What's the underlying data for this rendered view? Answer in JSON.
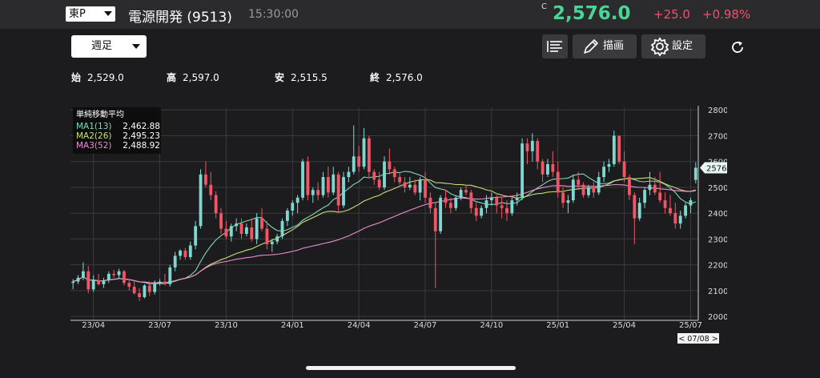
{
  "header": {
    "market": "東P",
    "stock_name": "電源開発 (9513)",
    "time": "15:30:00",
    "close_flag": "C",
    "price": "2,576.0",
    "change": "+25.0",
    "change_pct": "+0.98%",
    "colors": {
      "up": "#48d597",
      "down": "#f0506e"
    }
  },
  "toolbar": {
    "period": "週足",
    "draw_label": "描画",
    "settings_label": "設定",
    "icons": [
      "list-icon",
      "pencil-icon",
      "gear-icon",
      "refresh-icon"
    ]
  },
  "ohlc": {
    "open_label": "始",
    "open": "2,529.0",
    "high_label": "高",
    "high": "2,597.0",
    "low_label": "安",
    "low": "2,515.5",
    "close_label": "終",
    "close": "2,576.0"
  },
  "legend": {
    "title": "単純移動平均",
    "items": [
      {
        "name": "MA1(13)",
        "value": "2,462.88",
        "color": "#7fd9b6"
      },
      {
        "name": "MA2(26)",
        "value": "2,495.23",
        "color": "#c8e07a"
      },
      {
        "name": "MA3(52)",
        "value": "2,488.92",
        "color": "#e88fd0"
      }
    ]
  },
  "chart_data": {
    "type": "candlestick",
    "ylim": [
      1985,
      2810
    ],
    "y_ticks": [
      "2000",
      "2100",
      "2200",
      "2300",
      "2400",
      "2500",
      "2600",
      "2700",
      "2800"
    ],
    "x_ticks": [
      {
        "label": "23/04",
        "index": 4
      },
      {
        "label": "23/07",
        "index": 17
      },
      {
        "label": "23/10",
        "index": 30
      },
      {
        "label": "24/01",
        "index": 43
      },
      {
        "label": "24/04",
        "index": 56
      },
      {
        "label": "24/07",
        "index": 69
      },
      {
        "label": "24/10",
        "index": 82
      },
      {
        "label": "25/01",
        "index": 95
      },
      {
        "label": "25/04",
        "index": 108
      },
      {
        "label": "25/07",
        "index": 121
      }
    ],
    "last_price_label": "2576.0",
    "last_price": 2576,
    "date_label": "< 07/08 >",
    "up_color": "#7fd8d0",
    "down_color": "#f25565",
    "ma_colors": [
      "#7fd9b6",
      "#c8e07a",
      "#e88fd0"
    ],
    "candles": [
      [
        2130,
        2145,
        2105,
        2135
      ],
      [
        2135,
        2160,
        2125,
        2150
      ],
      [
        2150,
        2210,
        2140,
        2175
      ],
      [
        2175,
        2195,
        2090,
        2105
      ],
      [
        2105,
        2160,
        2095,
        2140
      ],
      [
        2140,
        2165,
        2120,
        2125
      ],
      [
        2125,
        2150,
        2110,
        2140
      ],
      [
        2140,
        2175,
        2130,
        2165
      ],
      [
        2165,
        2180,
        2150,
        2160
      ],
      [
        2160,
        2185,
        2145,
        2175
      ],
      [
        2175,
        2180,
        2120,
        2130
      ],
      [
        2130,
        2145,
        2100,
        2115
      ],
      [
        2115,
        2140,
        2085,
        2090
      ],
      [
        2090,
        2110,
        2060,
        2075
      ],
      [
        2075,
        2125,
        2070,
        2120
      ],
      [
        2120,
        2135,
        2080,
        2095
      ],
      [
        2095,
        2140,
        2085,
        2130
      ],
      [
        2130,
        2145,
        2120,
        2135
      ],
      [
        2135,
        2165,
        2120,
        2125
      ],
      [
        2125,
        2200,
        2115,
        2190
      ],
      [
        2190,
        2250,
        2175,
        2235
      ],
      [
        2235,
        2260,
        2220,
        2255
      ],
      [
        2255,
        2265,
        2220,
        2230
      ],
      [
        2230,
        2290,
        2220,
        2275
      ],
      [
        2275,
        2370,
        2260,
        2350
      ],
      [
        2350,
        2570,
        2340,
        2550
      ],
      [
        2550,
        2600,
        2500,
        2510
      ],
      [
        2510,
        2560,
        2450,
        2470
      ],
      [
        2470,
        2485,
        2380,
        2400
      ],
      [
        2400,
        2420,
        2320,
        2340
      ],
      [
        2340,
        2370,
        2300,
        2310
      ],
      [
        2310,
        2360,
        2290,
        2350
      ],
      [
        2350,
        2380,
        2330,
        2360
      ],
      [
        2360,
        2380,
        2300,
        2320
      ],
      [
        2320,
        2360,
        2310,
        2345
      ],
      [
        2345,
        2380,
        2290,
        2300
      ],
      [
        2300,
        2400,
        2280,
        2380
      ],
      [
        2380,
        2420,
        2330,
        2340
      ],
      [
        2340,
        2370,
        2260,
        2280
      ],
      [
        2280,
        2300,
        2250,
        2290
      ],
      [
        2290,
        2320,
        2280,
        2310
      ],
      [
        2310,
        2380,
        2300,
        2370
      ],
      [
        2370,
        2420,
        2350,
        2410
      ],
      [
        2410,
        2450,
        2390,
        2440
      ],
      [
        2440,
        2470,
        2400,
        2460
      ],
      [
        2460,
        2610,
        2450,
        2600
      ],
      [
        2600,
        2620,
        2450,
        2470
      ],
      [
        2470,
        2500,
        2440,
        2490
      ],
      [
        2490,
        2520,
        2450,
        2470
      ],
      [
        2470,
        2560,
        2460,
        2540
      ],
      [
        2540,
        2580,
        2460,
        2480
      ],
      [
        2480,
        2580,
        2470,
        2550
      ],
      [
        2550,
        2560,
        2400,
        2430
      ],
      [
        2430,
        2560,
        2420,
        2540
      ],
      [
        2540,
        2580,
        2520,
        2560
      ],
      [
        2560,
        2740,
        2550,
        2620
      ],
      [
        2620,
        2660,
        2560,
        2580
      ],
      [
        2580,
        2730,
        2570,
        2690
      ],
      [
        2690,
        2700,
        2540,
        2560
      ],
      [
        2560,
        2570,
        2510,
        2530
      ],
      [
        2530,
        2560,
        2490,
        2500
      ],
      [
        2500,
        2620,
        2490,
        2600
      ],
      [
        2600,
        2650,
        2550,
        2570
      ],
      [
        2570,
        2580,
        2520,
        2540
      ],
      [
        2540,
        2560,
        2510,
        2520
      ],
      [
        2520,
        2540,
        2480,
        2500
      ],
      [
        2500,
        2540,
        2490,
        2510
      ],
      [
        2510,
        2530,
        2470,
        2480
      ],
      [
        2480,
        2540,
        2450,
        2530
      ],
      [
        2530,
        2560,
        2440,
        2460
      ],
      [
        2460,
        2480,
        2400,
        2420
      ],
      [
        2420,
        2440,
        2110,
        2330
      ],
      [
        2330,
        2470,
        2320,
        2460
      ],
      [
        2460,
        2490,
        2420,
        2440
      ],
      [
        2440,
        2460,
        2400,
        2420
      ],
      [
        2420,
        2470,
        2410,
        2460
      ],
      [
        2460,
        2500,
        2450,
        2490
      ],
      [
        2490,
        2510,
        2470,
        2480
      ],
      [
        2480,
        2490,
        2400,
        2420
      ],
      [
        2420,
        2440,
        2370,
        2390
      ],
      [
        2390,
        2430,
        2380,
        2420
      ],
      [
        2420,
        2470,
        2400,
        2450
      ],
      [
        2450,
        2480,
        2430,
        2460
      ],
      [
        2460,
        2470,
        2400,
        2430
      ],
      [
        2430,
        2460,
        2380,
        2420
      ],
      [
        2420,
        2450,
        2370,
        2400
      ],
      [
        2400,
        2460,
        2390,
        2450
      ],
      [
        2450,
        2480,
        2430,
        2460
      ],
      [
        2460,
        2690,
        2450,
        2670
      ],
      [
        2670,
        2690,
        2590,
        2640
      ],
      [
        2640,
        2710,
        2600,
        2680
      ],
      [
        2680,
        2690,
        2570,
        2600
      ],
      [
        2600,
        2610,
        2520,
        2550
      ],
      [
        2550,
        2610,
        2540,
        2590
      ],
      [
        2590,
        2640,
        2540,
        2560
      ],
      [
        2560,
        2600,
        2460,
        2480
      ],
      [
        2480,
        2500,
        2420,
        2440
      ],
      [
        2440,
        2470,
        2400,
        2450
      ],
      [
        2450,
        2550,
        2440,
        2530
      ],
      [
        2530,
        2560,
        2490,
        2510
      ],
      [
        2510,
        2520,
        2460,
        2470
      ],
      [
        2470,
        2510,
        2460,
        2500
      ],
      [
        2500,
        2520,
        2460,
        2480
      ],
      [
        2480,
        2560,
        2470,
        2540
      ],
      [
        2540,
        2600,
        2520,
        2580
      ],
      [
        2580,
        2610,
        2560,
        2590
      ],
      [
        2590,
        2720,
        2580,
        2700
      ],
      [
        2700,
        2700,
        2590,
        2600
      ],
      [
        2600,
        2640,
        2520,
        2540
      ],
      [
        2540,
        2550,
        2450,
        2470
      ],
      [
        2470,
        2480,
        2280,
        2380
      ],
      [
        2380,
        2460,
        2370,
        2440
      ],
      [
        2440,
        2500,
        2420,
        2490
      ],
      [
        2490,
        2560,
        2470,
        2510
      ],
      [
        2510,
        2540,
        2470,
        2480
      ],
      [
        2480,
        2560,
        2440,
        2450
      ],
      [
        2450,
        2480,
        2400,
        2420
      ],
      [
        2420,
        2470,
        2390,
        2400
      ],
      [
        2400,
        2440,
        2340,
        2360
      ],
      [
        2360,
        2410,
        2340,
        2390
      ],
      [
        2390,
        2440,
        2380,
        2430
      ],
      [
        2430,
        2460,
        2400,
        2450
      ],
      [
        2529,
        2597,
        2515,
        2576
      ]
    ]
  }
}
